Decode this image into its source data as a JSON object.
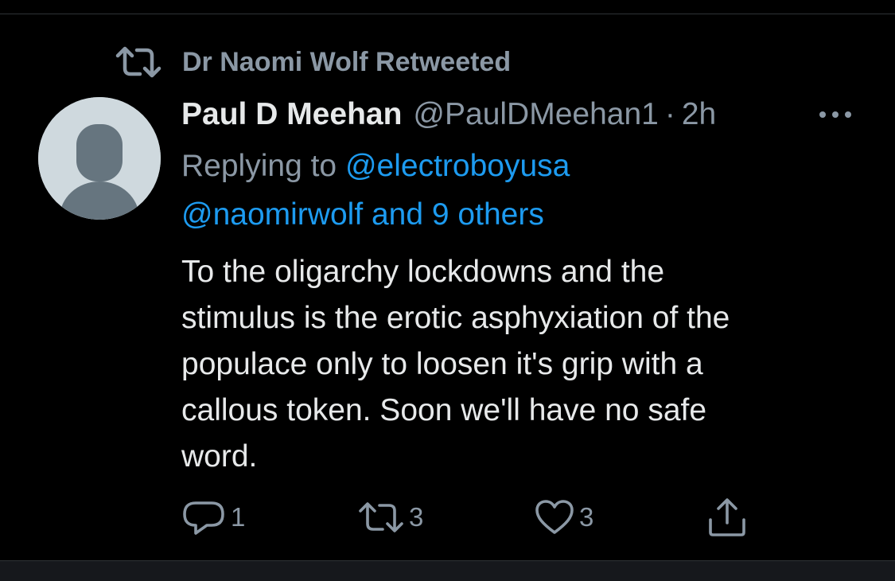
{
  "retweet_banner": {
    "label": "Dr Naomi Wolf Retweeted",
    "icon": "retweet-icon"
  },
  "tweet": {
    "author": {
      "display_name": "Paul D Meehan",
      "handle": "@PaulDMeehan1",
      "avatar": "default-avatar"
    },
    "separator": "·",
    "time": "2h",
    "more_icon": "more-icon",
    "replying": {
      "prefix": "Replying to ",
      "mention_1": "@electroboyusa",
      "mention_2": "@naomirwolf and 9 others"
    },
    "body": "To the oligarchy lockdowns and the\nstimulus is the erotic asphyxiation of the\npopulace only to loosen it's grip with a\ncallous token.   Soon we'll have no safe\nword."
  },
  "actions": {
    "reply": {
      "icon": "reply-icon",
      "count": "1"
    },
    "retweet": {
      "icon": "retweet-icon",
      "count": "3"
    },
    "like": {
      "icon": "heart-icon",
      "count": "3"
    },
    "share": {
      "icon": "share-icon"
    }
  },
  "colors": {
    "background": "#000000",
    "text_primary": "#e7e9ea",
    "text_secondary": "#8b98a5",
    "link": "#1d9bf0",
    "avatar_bg": "#cfd9de",
    "avatar_figure": "#66757f"
  }
}
